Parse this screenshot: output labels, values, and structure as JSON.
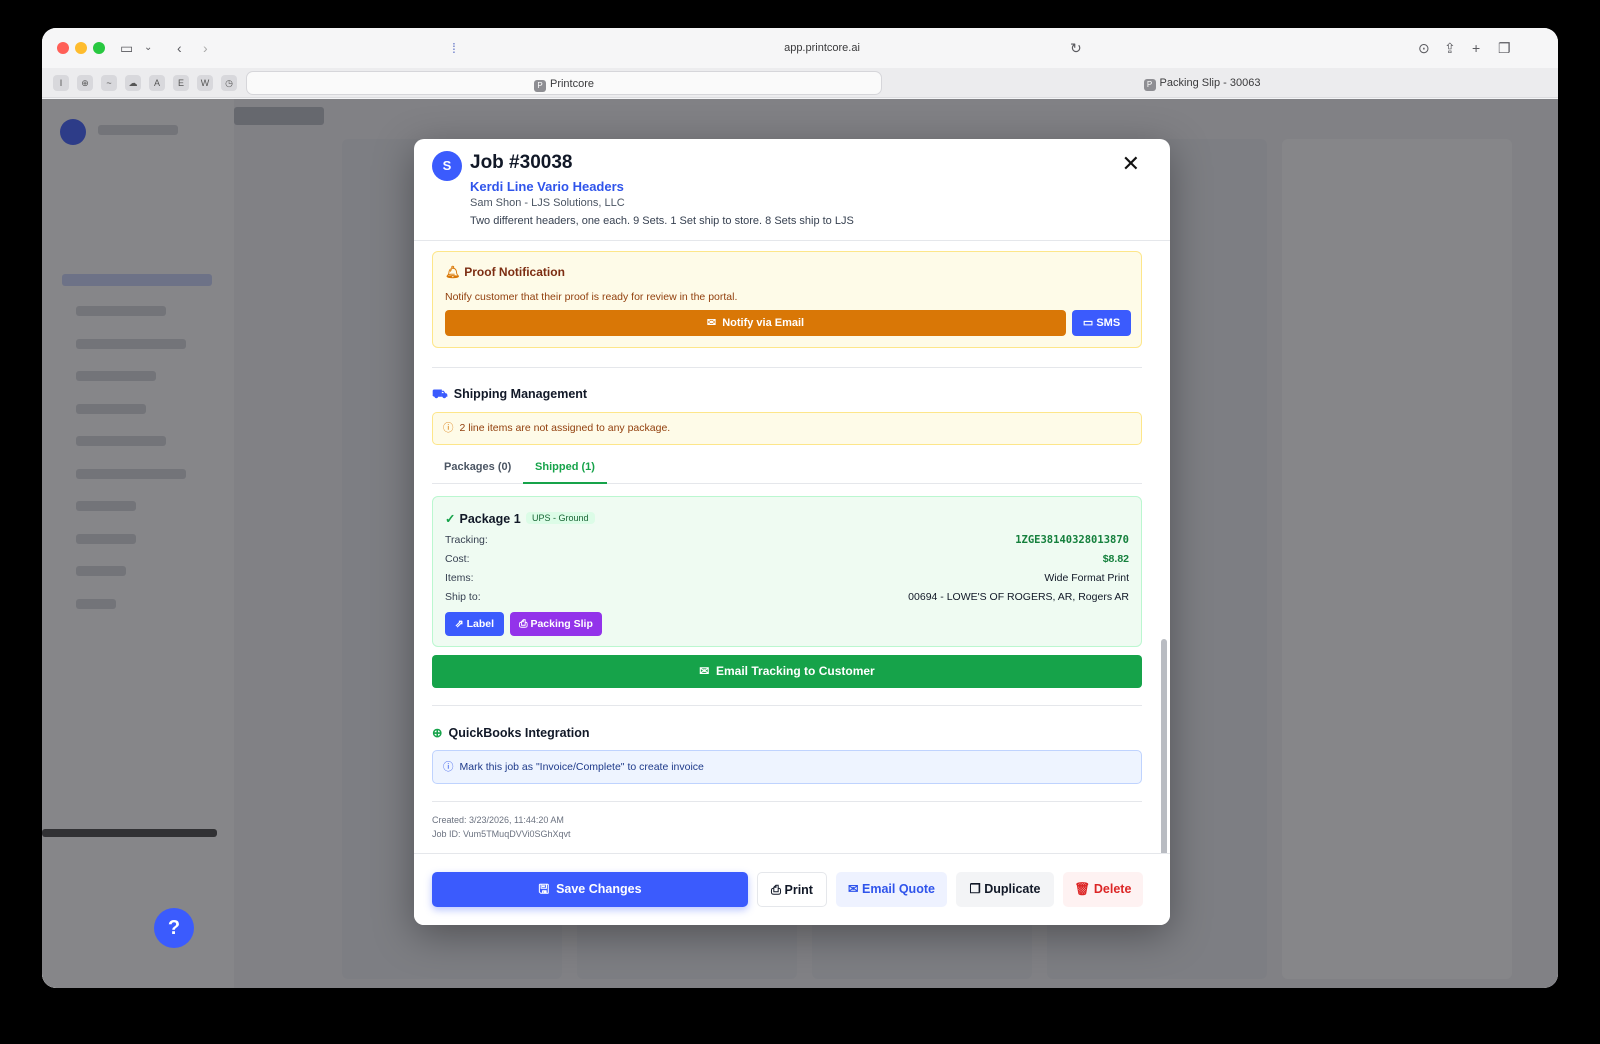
{
  "browser": {
    "url": "app.printcore.ai",
    "tabs": [
      {
        "label": "Printcore",
        "active": true
      },
      {
        "label": "Packing Slip - 30063",
        "active": false
      }
    ],
    "favorites": [
      "I",
      "⊕",
      "~",
      "☁",
      "A",
      "E",
      "W",
      "◷"
    ]
  },
  "modal": {
    "avatar_initial": "S",
    "title": "Job #30038",
    "job_name": "Kerdi Line Vario Headers",
    "customer": "Sam Shon - LJS Solutions, LLC",
    "description": "Two different headers, one each. 9 Sets. 1 Set ship to store. 8 Sets ship to LJS",
    "close_glyph": "✕",
    "proof": {
      "title": "Proof Notification",
      "text": "Notify customer that their proof is ready for review in the portal.",
      "notify_email_label": "Notify via Email",
      "sms_label": "SMS"
    },
    "shipping": {
      "title": "Shipping Management",
      "warning": "2 line items are not assigned to any package.",
      "tabs": {
        "packages": "Packages (0)",
        "shipped": "Shipped (1)"
      },
      "package": {
        "title": "Package 1",
        "carrier": "UPS - Ground",
        "rows": [
          {
            "key": "Tracking:",
            "value": "1ZGE38140328013870"
          },
          {
            "key": "Cost:",
            "value": "$8.82"
          },
          {
            "key": "Items:",
            "value": "Wide Format Print"
          },
          {
            "key": "Ship to:",
            "value": "00694 - LOWE'S OF ROGERS, AR, Rogers AR"
          }
        ],
        "label_btn": "Label",
        "packing_slip_btn": "Packing Slip"
      },
      "email_tracking_btn": "Email Tracking to Customer"
    },
    "quickbooks": {
      "title": "QuickBooks Integration",
      "info": "Mark this job as \"Invoice/Complete\" to create invoice"
    },
    "meta": {
      "created": "Created: 3/23/2026, 11:44:20 AM",
      "job_id": "Job ID: Vum5TMuqDVVi0SGhXqvt"
    },
    "footer": {
      "save": "Save Changes",
      "print": "Print",
      "email_quote": "Email Quote",
      "duplicate": "Duplicate",
      "delete": "Delete"
    }
  },
  "colors": {
    "primary": "#3b5bfd",
    "success": "#16a34a",
    "warning": "#d97706",
    "danger": "#dc2626",
    "purple": "#9333ea"
  }
}
